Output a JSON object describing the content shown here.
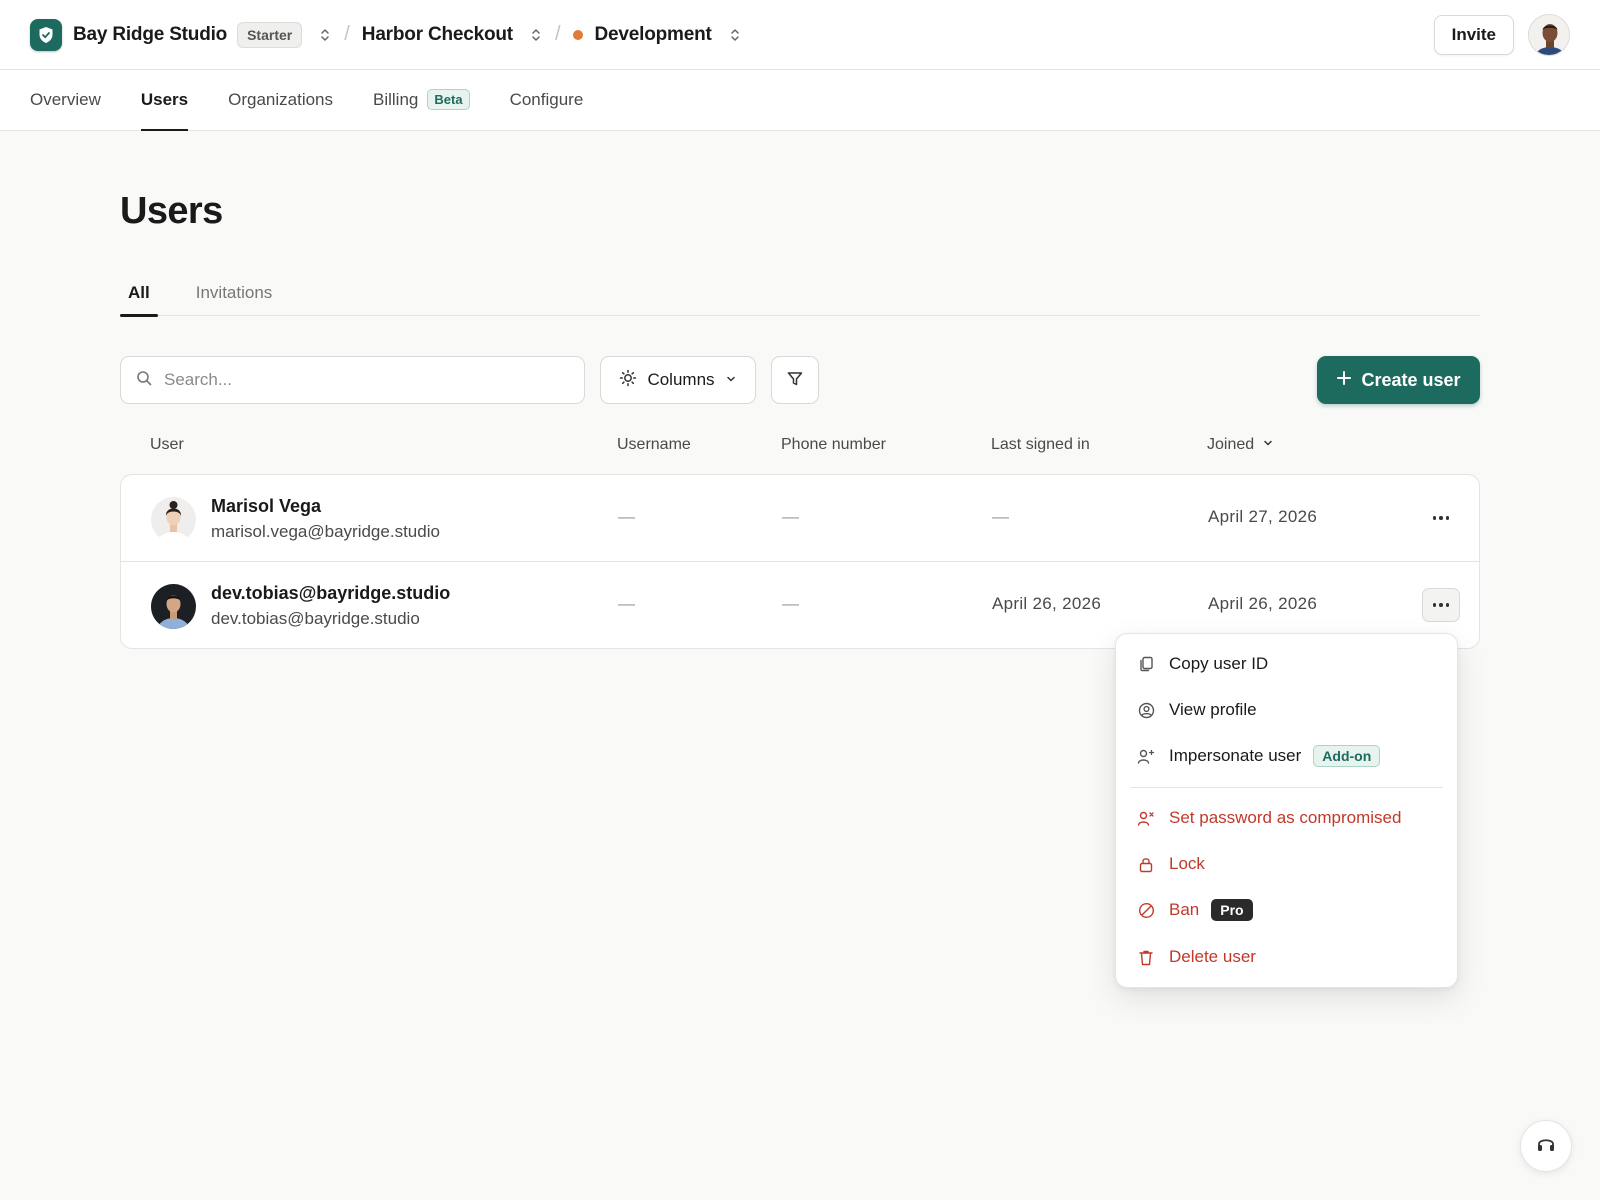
{
  "topbar": {
    "workspace_name": "Bay Ridge Studio",
    "plan_badge": "Starter",
    "app_name": "Harbor Checkout",
    "environment": "Development",
    "environment_color": "#e07b39",
    "invite_label": "Invite"
  },
  "nav": {
    "tabs": [
      {
        "label": "Overview"
      },
      {
        "label": "Users",
        "active": true
      },
      {
        "label": "Organizations"
      },
      {
        "label": "Billing",
        "badge": "Beta"
      },
      {
        "label": "Configure"
      }
    ]
  },
  "page": {
    "title": "Users",
    "subtabs": [
      {
        "label": "All",
        "active": true
      },
      {
        "label": "Invitations"
      }
    ]
  },
  "toolbar": {
    "search_placeholder": "Search...",
    "columns_label": "Columns",
    "create_label": "Create user"
  },
  "table": {
    "columns": [
      "User",
      "Username",
      "Phone number",
      "Last signed in",
      "Joined"
    ],
    "sorted_column": "Joined",
    "rows": [
      {
        "name": "Marisol Vega",
        "email": "marisol.vega@bayridge.studio",
        "username": "—",
        "phone": "—",
        "last_signed_in": "—",
        "joined": "April 27, 2026"
      },
      {
        "name": "dev.tobias@bayridge.studio",
        "email": "dev.tobias@bayridge.studio",
        "username": "—",
        "phone": "—",
        "last_signed_in": "April 26, 2026",
        "joined": "April 26, 2026"
      }
    ]
  },
  "menu": {
    "copy_id": "Copy user ID",
    "view_profile": "View profile",
    "impersonate": "Impersonate user",
    "impersonate_badge": "Add-on",
    "set_compromised": "Set password as compromised",
    "lock": "Lock",
    "ban": "Ban",
    "ban_badge": "Pro",
    "delete": "Delete user"
  },
  "colors": {
    "brand": "#1d6b5e",
    "danger": "#c0392b"
  }
}
